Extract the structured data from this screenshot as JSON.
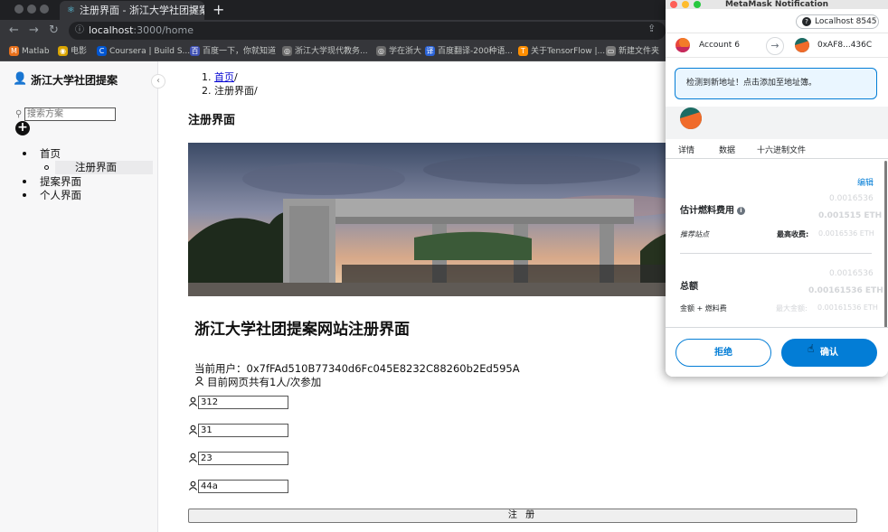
{
  "browser": {
    "tab_title": "注册界面 - 浙江大学社团提案",
    "tab_close": "✕",
    "new_tab": "+",
    "url_host": "localhost",
    "url_path": ":3000/home",
    "bookmarks": [
      {
        "label": "Matlab",
        "color": "#e8711c",
        "icon": "M"
      },
      {
        "label": "电影",
        "color": "#d9a400",
        "icon": "◉"
      },
      {
        "label": "Coursera | Build S...",
        "color": "#0056d2",
        "icon": "C"
      },
      {
        "label": "百度一下，你就知道",
        "color": "#3f51b5",
        "icon": "百"
      },
      {
        "label": "浙江大学现代教务...",
        "color": "#6b6b6b",
        "icon": "◎"
      },
      {
        "label": "学在浙大",
        "color": "#6b6b6b",
        "icon": "◎"
      },
      {
        "label": "百度翻译-200种语...",
        "color": "#2b64d8",
        "icon": "译"
      },
      {
        "label": "关于TensorFlow |...",
        "color": "#ff8f00",
        "icon": "T"
      },
      {
        "label": "新建文件夹",
        "color": "#7a7a7a",
        "icon": "▭"
      }
    ]
  },
  "sidebar": {
    "brand": "浙江大学社团提案",
    "search_placeholder": "搜索方案",
    "add_label": "+",
    "items": [
      {
        "label": "首页"
      },
      {
        "label": "注册界面"
      },
      {
        "label": "提案界面"
      },
      {
        "label": "个人界面"
      }
    ]
  },
  "main": {
    "breadcrumb": [
      {
        "num": "1.",
        "label": "首页",
        "sep": "/"
      },
      {
        "num": "2.",
        "label": "注册界面",
        "sep": "/"
      }
    ],
    "page_title": "注册界面",
    "heading": "浙江大学社团提案网站注册界面",
    "current_user": "当前用户：0x7fFAd510B77340d6Fc045E8232C88260b2Ed595A",
    "participants": "目前网页共有1人/次参加",
    "fields": [
      "312",
      "31",
      "23",
      "44a"
    ],
    "submit_label": "注 册"
  },
  "metamask": {
    "window_title": "MetaMask Notification",
    "network": "Localhost 8545",
    "from_account": "Account 6",
    "to_account": "0xAF8...436C",
    "alert": "检测到新地址！点击添加至地址簿。",
    "tabs": [
      "详情",
      "数据",
      "十六进制文件"
    ],
    "edit": "编辑",
    "faded_fee_top": "0.0016536",
    "faded_fee_eth": "0.001515 ETH",
    "gas_label": "估计燃料费用",
    "suggested_site": "推荐站点",
    "max_fee_label": "最高收费:",
    "faded_max_fee": "0.0016536 ETH",
    "faded_total_top": "0.0016536",
    "faded_total_eth": "0.00161536 ETH",
    "total_label": "总额",
    "amount_plus_gas": "金额 + 燃料费",
    "faded_max_amount_label": "最大金额:",
    "faded_max_amount": "0.00161536 ETH",
    "reject": "拒绝",
    "confirm": "确认",
    "colors": {
      "accent": "#037dd6"
    }
  }
}
